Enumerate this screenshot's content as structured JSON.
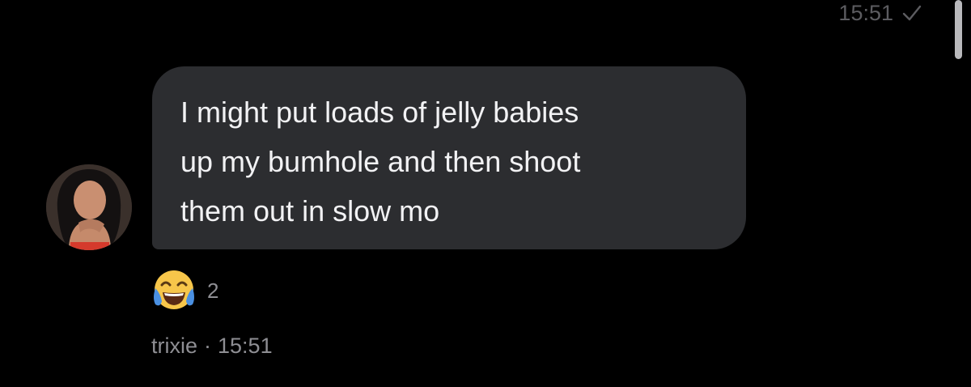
{
  "previous_message": {
    "time": "15:51",
    "status_icon": "check-icon"
  },
  "message": {
    "lines": [
      "I might put loads of jelly babies",
      "up my bumhole and then shoot",
      "them out in slow mo"
    ],
    "sender": "trixie",
    "separator": "·",
    "time": "15:51"
  },
  "reaction": {
    "emoji_icon": "face-with-tears-of-joy-icon",
    "count": "2"
  },
  "colors": {
    "background": "#000000",
    "bubble": "#2c2d30",
    "message_text": "#f2f2f4",
    "meta_text": "#8e8e93",
    "emoji_yellow": "#f7c64a",
    "tears_blue": "#4a90e2"
  }
}
